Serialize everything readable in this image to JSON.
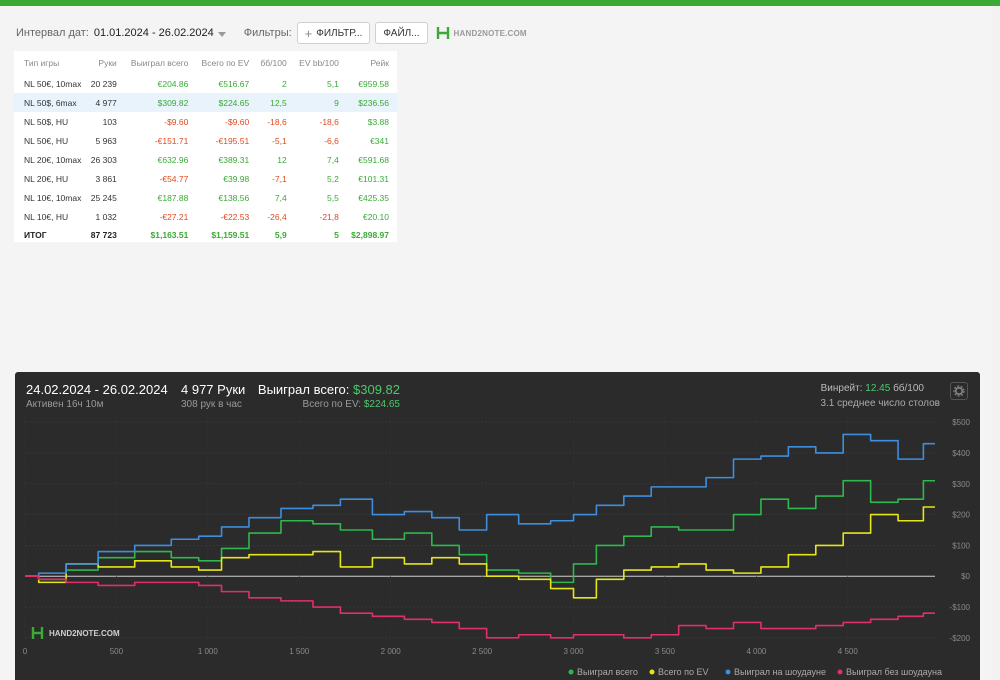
{
  "filters": {
    "interval_label": "Интервал дат:",
    "interval_value": "01.01.2024 - 26.02.2024",
    "filters_label": "Фильтры:",
    "filter_button": "ФИЛЬТР...",
    "file_button": "ФАЙЛ...",
    "logo_text": "HAND2NOTE.COM"
  },
  "stats_table": {
    "headers": [
      "Тип игры",
      "Руки",
      "Выиграл всего",
      "Всего по EV",
      "бб/100",
      "EV bb/100",
      "Рейк"
    ],
    "rows": [
      {
        "game": "NL 50€, 10max",
        "hands": "20 239",
        "won": "€204.86",
        "ev": "€516.67",
        "bb100": "2",
        "evbb": "5,1",
        "rake": "€959.58"
      },
      {
        "game": "NL 50$, 6max",
        "hands": "4 977",
        "won": "$309.82",
        "ev": "$224.65",
        "bb100": "12,5",
        "evbb": "9",
        "rake": "$236.56"
      },
      {
        "game": "NL 50$, HU",
        "hands": "103",
        "won": "-$9.60",
        "ev": "-$9.60",
        "bb100": "-18,6",
        "evbb": "-18,6",
        "rake": "$3.88"
      },
      {
        "game": "NL 50€, HU",
        "hands": "5 963",
        "won": "-€151.71",
        "ev": "-€195.51",
        "bb100": "-5,1",
        "evbb": "-6,6",
        "rake": "€341"
      },
      {
        "game": "NL 20€, 10max",
        "hands": "26 303",
        "won": "€632.96",
        "ev": "€389.31",
        "bb100": "12",
        "evbb": "7,4",
        "rake": "€591.68"
      },
      {
        "game": "NL 20€, HU",
        "hands": "3 861",
        "won": "-€54.77",
        "ev": "€39.98",
        "bb100": "-7,1",
        "evbb": "5,2",
        "rake": "€101.31"
      },
      {
        "game": "NL 10€, 10max",
        "hands": "25 245",
        "won": "€187.88",
        "ev": "€138.56",
        "bb100": "7,4",
        "evbb": "5,5",
        "rake": "€425.35"
      },
      {
        "game": "NL 10€, HU",
        "hands": "1 032",
        "won": "-€27.21",
        "ev": "-€22.53",
        "bb100": "-26,4",
        "evbb": "-21,8",
        "rake": "€20.10"
      }
    ],
    "total": {
      "game": "ИТОГ",
      "hands": "87 723",
      "won": "$1,163.51",
      "ev": "$1,159.51",
      "bb100": "5,9",
      "evbb": "5",
      "rake": "$2,898.97"
    }
  },
  "session": {
    "date_range": "24.02.2024 - 26.02.2024",
    "active": "Активен 16ч 10м",
    "hands": "4 977 Руки",
    "hands_rate": "308 рук в час",
    "won_label": "Выиграл всего:",
    "won_value": "$309.82",
    "ev_label": "Всего по EV:",
    "ev_value": "$224.65",
    "winrate_label": "Винрейт:",
    "winrate_value": "12.45",
    "winrate_unit": "бб/100",
    "tables": "3.1 среднее число столов"
  },
  "chart_data": {
    "type": "line",
    "x_ticks": [
      "0",
      "500",
      "1 000",
      "1 500",
      "2 000",
      "2 500",
      "3 000",
      "3 500",
      "4 000",
      "4 500"
    ],
    "y_ticks": [
      "$500",
      "$400",
      "$300",
      "$200",
      "$100",
      "$0",
      "-$100",
      "-$200"
    ],
    "xlim": [
      0,
      4977
    ],
    "ylim": [
      -220,
      520
    ],
    "watermark": "HAND2NOTE.COM",
    "legend_placement": "bottom-right",
    "series": [
      {
        "name": "Выиграл всего",
        "color": "#2eb84d",
        "x": [
          0,
          150,
          300,
          500,
          700,
          900,
          1000,
          1150,
          1300,
          1500,
          1650,
          1800,
          2000,
          2150,
          2300,
          2450,
          2600,
          2800,
          2950,
          3050,
          3200,
          3350,
          3500,
          3650,
          3800,
          3950,
          4100,
          4250,
          4400,
          4550,
          4700,
          4850,
          4977
        ],
        "y": [
          0,
          -10,
          20,
          60,
          80,
          60,
          50,
          90,
          140,
          180,
          170,
          150,
          120,
          140,
          100,
          70,
          20,
          10,
          -20,
          40,
          100,
          130,
          160,
          150,
          150,
          200,
          250,
          220,
          260,
          310,
          240,
          250,
          309.82
        ]
      },
      {
        "name": "Всего по EV",
        "color": "#e5e51c",
        "x": [
          0,
          150,
          300,
          500,
          700,
          900,
          1000,
          1150,
          1300,
          1500,
          1650,
          1800,
          2000,
          2150,
          2300,
          2450,
          2600,
          2800,
          2950,
          3050,
          3200,
          3350,
          3500,
          3650,
          3800,
          3950,
          4100,
          4250,
          4400,
          4550,
          4700,
          4850,
          4977
        ],
        "y": [
          0,
          -20,
          40,
          30,
          50,
          30,
          20,
          60,
          70,
          70,
          80,
          30,
          60,
          40,
          60,
          40,
          0,
          -10,
          -40,
          -70,
          -10,
          20,
          30,
          40,
          20,
          10,
          30,
          70,
          100,
          140,
          200,
          180,
          224.65
        ]
      },
      {
        "name": "Выиграл на шоудауне",
        "color": "#3d8ee0",
        "x": [
          0,
          150,
          300,
          500,
          700,
          900,
          1000,
          1150,
          1300,
          1500,
          1650,
          1800,
          2000,
          2150,
          2300,
          2450,
          2600,
          2800,
          2950,
          3050,
          3200,
          3350,
          3500,
          3650,
          3800,
          3950,
          4100,
          4250,
          4400,
          4550,
          4700,
          4850,
          4977
        ],
        "y": [
          0,
          10,
          40,
          80,
          100,
          120,
          130,
          160,
          190,
          220,
          230,
          250,
          200,
          210,
          190,
          150,
          200,
          170,
          180,
          200,
          230,
          260,
          290,
          290,
          320,
          380,
          390,
          420,
          400,
          460,
          440,
          380,
          430
        ]
      },
      {
        "name": "Выиграл без шоудауна",
        "color": "#e0306a",
        "x": [
          0,
          150,
          300,
          500,
          700,
          900,
          1000,
          1150,
          1300,
          1500,
          1650,
          1800,
          2000,
          2150,
          2300,
          2450,
          2600,
          2800,
          2950,
          3050,
          3200,
          3350,
          3500,
          3650,
          3800,
          3950,
          4100,
          4250,
          4400,
          4550,
          4700,
          4850,
          4977
        ],
        "y": [
          0,
          -10,
          -20,
          -30,
          -20,
          -20,
          -30,
          -50,
          -70,
          -80,
          -100,
          -120,
          -130,
          -140,
          -150,
          -170,
          -200,
          -190,
          -200,
          -190,
          -190,
          -200,
          -190,
          -160,
          -170,
          -150,
          -170,
          -170,
          -160,
          -150,
          -140,
          -130,
          -120
        ]
      }
    ]
  }
}
